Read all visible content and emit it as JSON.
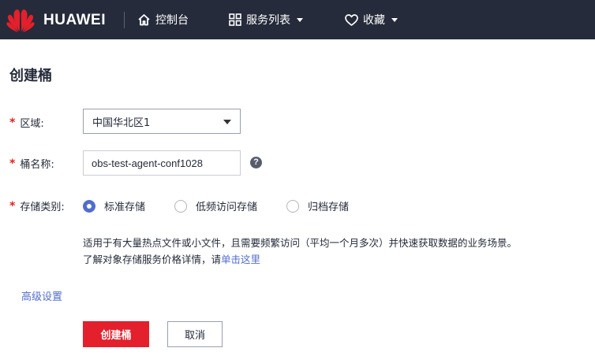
{
  "header": {
    "brand": "HUAWEI",
    "nav": {
      "console_label": "控制台",
      "services_label": "服务列表",
      "favorites_label": "收藏"
    }
  },
  "page": {
    "title": "创建桶"
  },
  "form": {
    "region": {
      "label": "区域:",
      "value": "中国华北区1"
    },
    "bucket_name": {
      "label": "桶名称:",
      "value": "obs-test-agent-conf1028"
    },
    "storage_class": {
      "label": "存储类别:",
      "options": [
        {
          "label": "标准存储",
          "selected": true
        },
        {
          "label": "低频访问存储",
          "selected": false
        },
        {
          "label": "归档存储",
          "selected": false
        }
      ]
    },
    "description": {
      "line1": "适用于有大量热点文件或小文件，且需要频繁访问（平均一个月多次）并快速获取数据的业务场景。",
      "line2_prefix": "了解对象存储服务价格详情，请",
      "line2_link": "单击这里"
    },
    "advanced_settings": "高级设置"
  },
  "actions": {
    "create_label": "创建桶",
    "cancel_label": "取消"
  },
  "colors": {
    "topbar": "#252b3a",
    "primary_button": "#e3202b",
    "link": "#526ecc",
    "required": "#e02020"
  }
}
